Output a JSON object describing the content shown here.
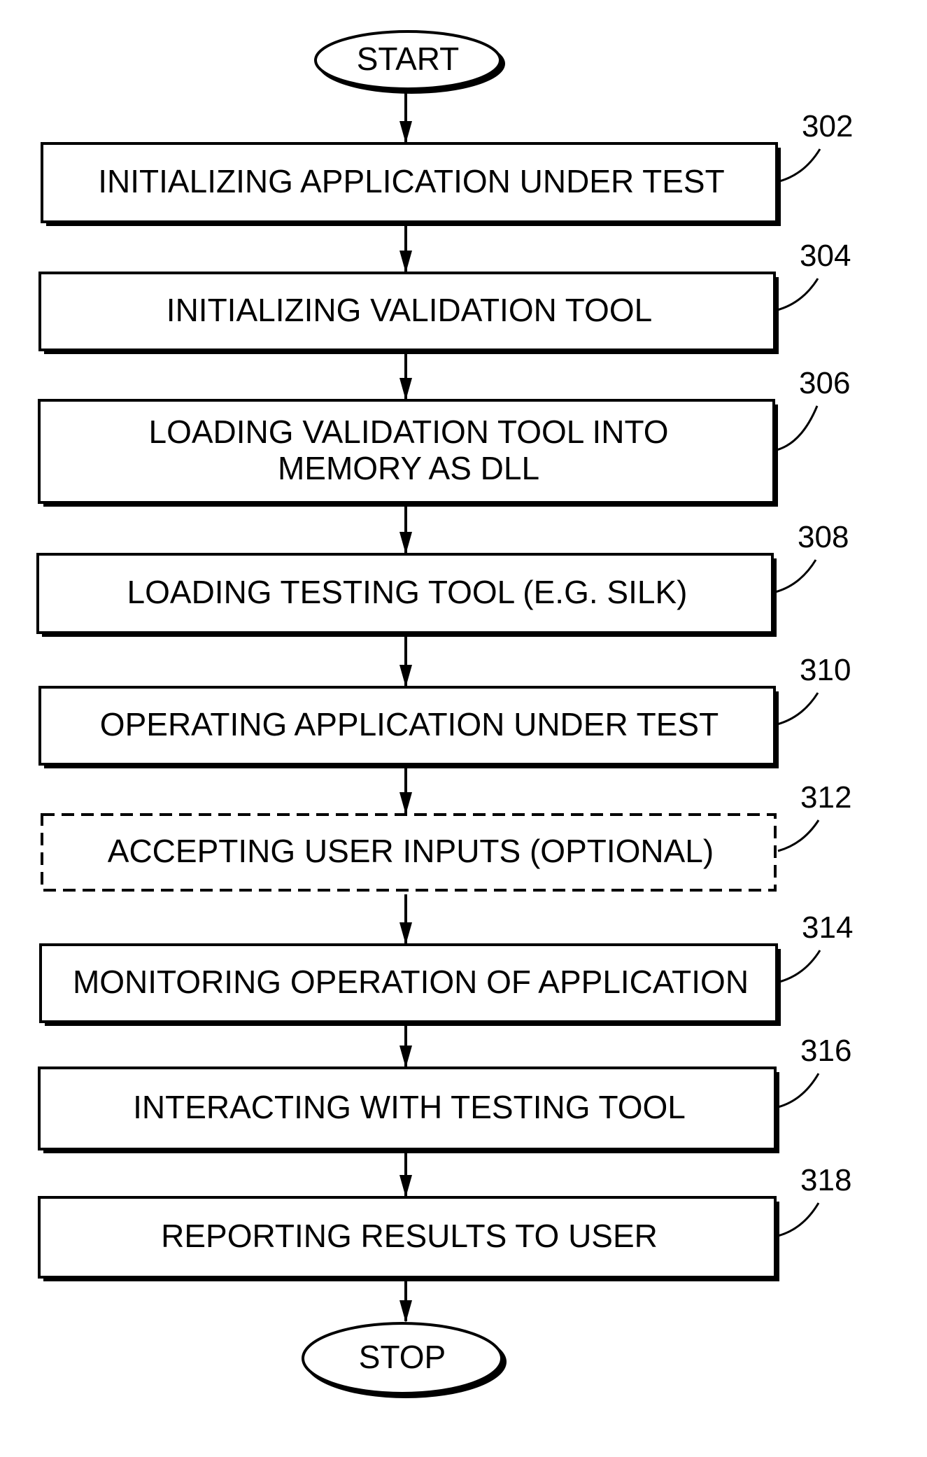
{
  "terminals": {
    "start": "START",
    "stop": "STOP"
  },
  "steps": [
    {
      "ref": "302",
      "lines": [
        "INITIALIZING APPLICATION UNDER TEST"
      ],
      "optional": false
    },
    {
      "ref": "304",
      "lines": [
        "INITIALIZING VALIDATION TOOL"
      ],
      "optional": false
    },
    {
      "ref": "306",
      "lines": [
        "LOADING VALIDATION TOOL INTO",
        "MEMORY AS DLL"
      ],
      "optional": false
    },
    {
      "ref": "308",
      "lines": [
        "LOADING TESTING TOOL (E.G. SILK)"
      ],
      "optional": false
    },
    {
      "ref": "310",
      "lines": [
        "OPERATING APPLICATION UNDER TEST"
      ],
      "optional": false
    },
    {
      "ref": "312",
      "lines": [
        "ACCEPTING USER INPUTS (OPTIONAL)"
      ],
      "optional": true
    },
    {
      "ref": "314",
      "lines": [
        "MONITORING OPERATION OF APPLICATION"
      ],
      "optional": false
    },
    {
      "ref": "316",
      "lines": [
        "INTERACTING WITH TESTING TOOL"
      ],
      "optional": false
    },
    {
      "ref": "318",
      "lines": [
        "REPORTING RESULTS TO USER"
      ],
      "optional": false
    }
  ]
}
